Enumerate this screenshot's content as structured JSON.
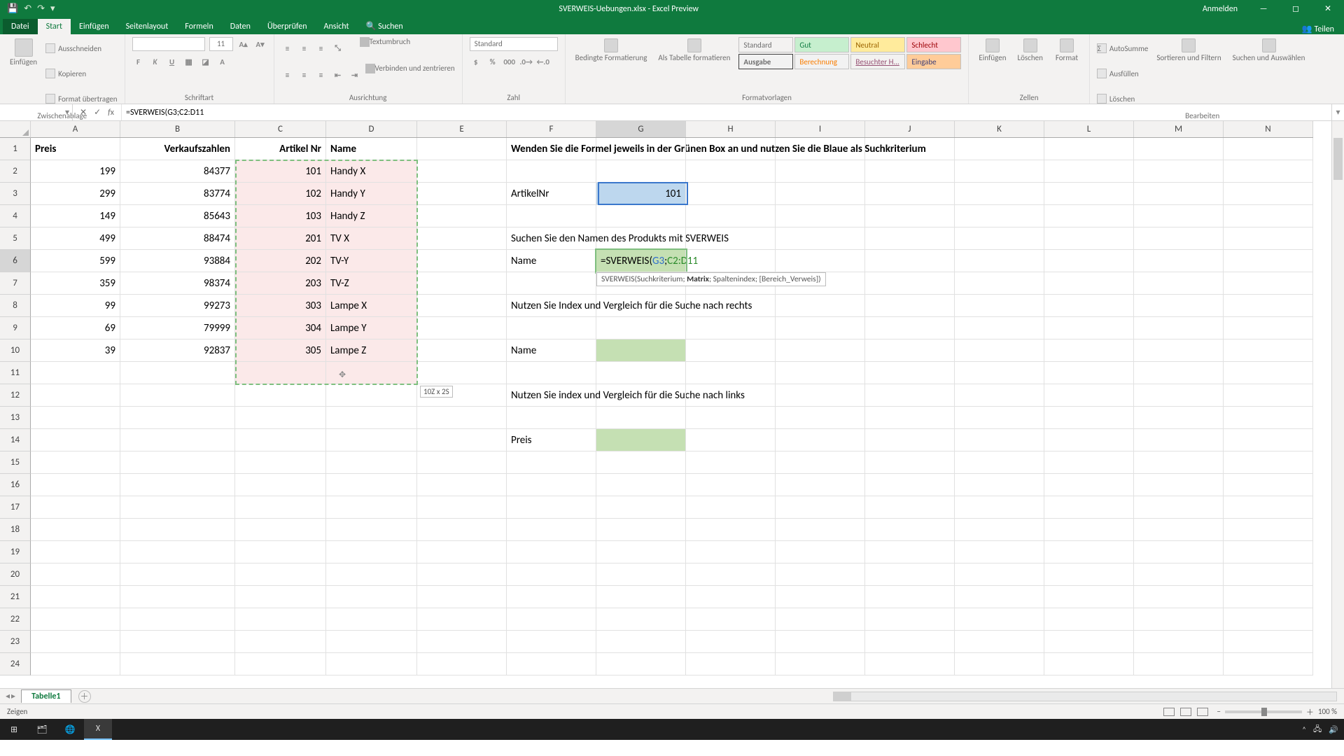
{
  "titlebar": {
    "title": "SVERWEIS-Uebungen.xlsx - Excel Preview",
    "signin": "Anmelden"
  },
  "tabs": {
    "file": "Datei",
    "home": "Start",
    "insert": "Einfügen",
    "layout": "Seitenlayout",
    "formulas": "Formeln",
    "data": "Daten",
    "review": "Überprüfen",
    "view": "Ansicht",
    "search": "Suchen",
    "share": "Teilen"
  },
  "ribbon": {
    "clipboard": {
      "paste": "Einfügen",
      "cut": "Ausschneiden",
      "copy": "Kopieren",
      "format": "Format übertragen",
      "label": "Zwischenablage"
    },
    "font": {
      "size": "11",
      "label": "Schriftart"
    },
    "align": {
      "wrap": "Textumbruch",
      "merge": "Verbinden und zentrieren",
      "label": "Ausrichtung"
    },
    "number": {
      "std": "Standard",
      "label": "Zahl"
    },
    "styles": {
      "cond": "Bedingte Formatierung",
      "table": "Als Tabelle formatieren",
      "s1": "Standard",
      "s2": "Gut",
      "s3": "Neutral",
      "s4": "Schlecht",
      "s5": "Ausgabe",
      "s6": "Berechnung",
      "s7": "Besuchter H...",
      "s8": "Eingabe",
      "label": "Formatvorlagen"
    },
    "cells": {
      "insert": "Einfügen",
      "delete": "Löschen",
      "format": "Format",
      "label": "Zellen"
    },
    "editing": {
      "sum": "AutoSumme",
      "fill": "Ausfüllen",
      "clear": "Löschen",
      "sort": "Sortieren und Filtern",
      "find": "Suchen und Auswählen",
      "label": "Bearbeiten"
    }
  },
  "namebox": "",
  "formula": "=SVERWEIS(G3;C2:D11",
  "formula_parts": {
    "pre": "=SVERWEIS(",
    "a1": "G3",
    "sep": ";",
    "a2": "C2:D11"
  },
  "tooltip": {
    "fn": "SVERWEIS(",
    "p1": "Suchkriterium; ",
    "p2": "Matrix",
    "p3": "; Spaltenindex; [Bereich_Verweis])"
  },
  "rangesize": "10Z x 2S",
  "cols": [
    "A",
    "B",
    "C",
    "D",
    "E",
    "F",
    "G",
    "H",
    "I",
    "J",
    "K",
    "L",
    "M",
    "N"
  ],
  "hdr": {
    "A": "Preis",
    "B": "Verkaufszahlen",
    "C": "Artikel Nr",
    "D": "Name"
  },
  "tableA": [
    {
      "a": "199",
      "b": "84377",
      "c": "101",
      "d": "Handy X"
    },
    {
      "a": "299",
      "b": "83774",
      "c": "102",
      "d": "Handy Y"
    },
    {
      "a": "149",
      "b": "85643",
      "c": "103",
      "d": "Handy Z"
    },
    {
      "a": "499",
      "b": "88474",
      "c": "201",
      "d": "TV X"
    },
    {
      "a": "599",
      "b": "93884",
      "c": "202",
      "d": "TV-Y"
    },
    {
      "a": "359",
      "b": "98374",
      "c": "203",
      "d": "TV-Z"
    },
    {
      "a": "99",
      "b": "99273",
      "c": "303",
      "d": "Lampe X"
    },
    {
      "a": "69",
      "b": "79999",
      "c": "304",
      "d": "Lampe Y"
    },
    {
      "a": "39",
      "b": "92837",
      "c": "305",
      "d": "Lampe Z"
    }
  ],
  "text": {
    "f1": "Wenden Sie die Formel jeweils in der Grünen Box an und nutzen Sie die Blaue als Suchkriterium",
    "f3": "ArtikelNr",
    "g3": "101",
    "f5": "Suchen Sie den Namen des Produkts mit SVERWEIS",
    "f6": "Name",
    "f8": "Nutzen Sie Index und Vergleich für die Suche nach rechts",
    "f10": "Name",
    "f12": "Nutzen Sie index und Vergleich für die Suche nach links",
    "f14": "Preis"
  },
  "sheet": {
    "tab": "Tabelle1"
  },
  "status": {
    "mode": "Zeigen",
    "zoom": "100 %"
  }
}
